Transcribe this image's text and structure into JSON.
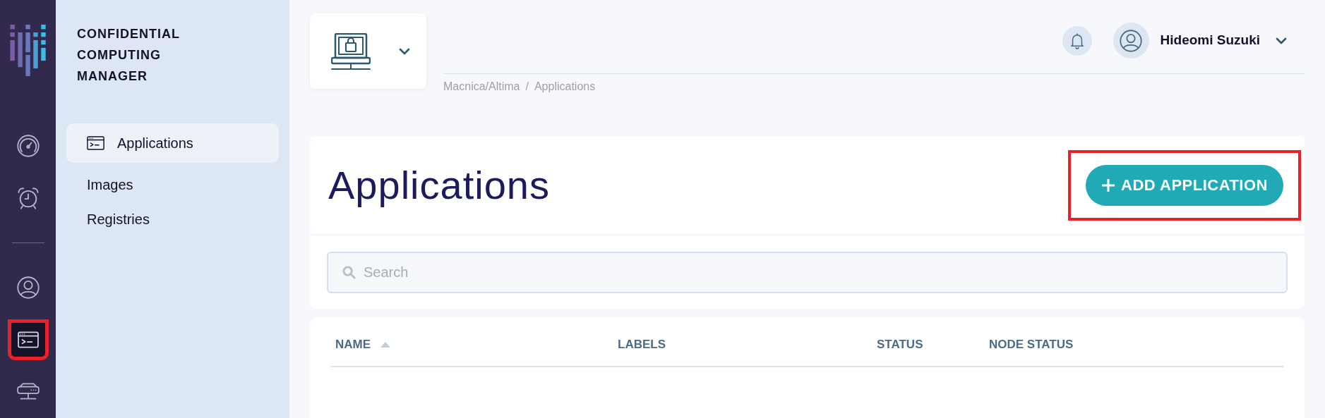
{
  "rail": {
    "items": [
      {
        "kind": "gauge",
        "selected": false,
        "highlighted": false
      },
      {
        "kind": "alarm",
        "selected": false,
        "highlighted": false
      },
      {
        "kind": "divider"
      },
      {
        "kind": "user",
        "selected": false,
        "highlighted": false
      },
      {
        "kind": "terminal",
        "selected": true,
        "highlighted": true
      },
      {
        "kind": "network",
        "selected": false,
        "highlighted": false
      }
    ]
  },
  "sidebar": {
    "title": "CONFIDENTIAL COMPUTING MANAGER",
    "items": [
      {
        "label": "Applications",
        "selected": true
      },
      {
        "label": "Images",
        "selected": false
      },
      {
        "label": "Registries",
        "selected": false
      }
    ]
  },
  "header": {
    "breadcrumb": [
      "Macnica/Altima",
      "/",
      "Applications"
    ],
    "user": "Hideomi Suzuki"
  },
  "page": {
    "title": "Applications",
    "add_button": {
      "label": "ADD APPLICATION",
      "highlighted": true
    },
    "search": {
      "placeholder": "Search"
    }
  },
  "table": {
    "columns": [
      {
        "label": "NAME",
        "sorted": true
      },
      {
        "label": "LABELS",
        "sorted": false
      },
      {
        "label": "STATUS",
        "sorted": false
      },
      {
        "label": "NODE STATUS",
        "sorted": false
      }
    ]
  }
}
